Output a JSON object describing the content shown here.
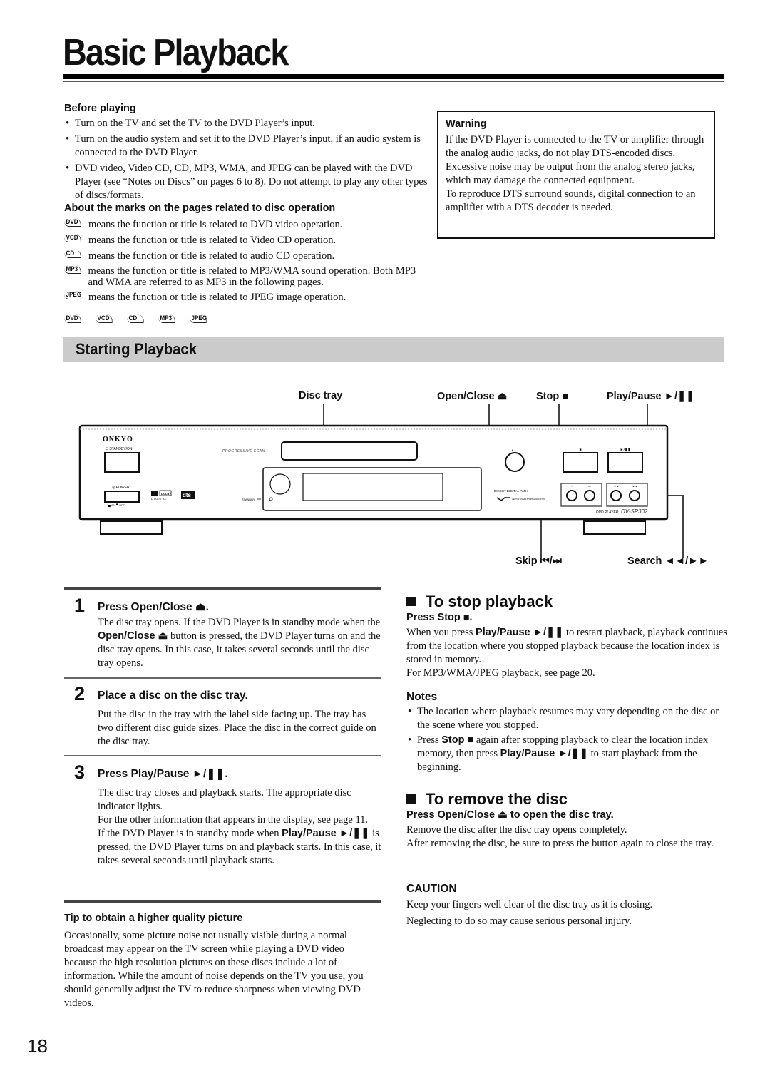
{
  "page": {
    "title": "Basic Playback",
    "page_number": "18"
  },
  "before_playing": {
    "heading": "Before playing",
    "bullets": [
      "Turn on the TV and set the TV to the DVD Player’s input.",
      "Turn on the audio system and set it to the DVD Player’s input, if an audio system is connected to the DVD Player.",
      "DVD video, Video CD, CD, MP3, WMA, and JPEG can be played with the DVD Player (see “Notes on Discs” on pages 6 to 8). Do not attempt to play any other types of discs/formats."
    ]
  },
  "marks": {
    "heading": "About the marks on the pages related to disc operation",
    "items": [
      {
        "icon": "DVD",
        "text": "means the function or title is related to DVD video operation."
      },
      {
        "icon": "VCD",
        "text": "means the function or title is related to Video CD operation."
      },
      {
        "icon": "CD",
        "text": "means the function or title is related to audio CD operation."
      },
      {
        "icon": "MP3",
        "text": "means the function or title is related to MP3/WMA sound operation. Both MP3 and WMA are referred to as MP3 in the following pages."
      },
      {
        "icon": "JPEG",
        "text": "means the function or title is related to JPEG image operation."
      }
    ],
    "applicable": [
      "DVD",
      "VCD",
      "CD",
      "MP3",
      "JPEG"
    ]
  },
  "warning": {
    "heading": "Warning",
    "para1": "If the DVD Player is connected to the TV or amplifier through the analog audio jacks, do not play DTS-encoded discs. Excessive noise may be output from the analog stereo jacks, which may damage the connected equipment.",
    "para2": "To reproduce DTS surround sounds, digital connection to an amplifier with a DTS decoder is needed."
  },
  "starting": {
    "heading": "Starting Playback",
    "callouts": {
      "disc_tray": "Disc tray",
      "open_close": "Open/Close ⏏",
      "stop": "Stop ■",
      "play_pause": "Play/Pause ►/❚❚",
      "skip": "Skip ⏮/⏭",
      "search": "Search ◄◄/►►"
    },
    "device": {
      "brand": "ONKYO",
      "standby_on": "⏻ STANDBY/ON",
      "power": "◎ POWER",
      "on_off": "▄ ON  ▀ OFF",
      "progressive": "PROGRESSIVE SCAN",
      "standby": "STANDBY",
      "dolby": "DOLBY",
      "digital": "D I G I T A L",
      "dts": "dts",
      "direct_digital": "DIRECT DIGITAL PATH",
      "vl": "VECTOR LINEAR SHAPING CIRCUITRY",
      "model_label": "DVD PLAYER",
      "model": "DV-SP302",
      "eject_glyph": "▲",
      "stop_glyph": "■",
      "play_glyph": "►/❚❚",
      "prev_glyph": "⏮",
      "next_glyph": "⏭",
      "rew_glyph": "◄◄",
      "ff_glyph": "►►"
    }
  },
  "steps": [
    {
      "num": "1",
      "title": "Press Open/Close ⏏.",
      "body_a": "The disc tray opens. If the DVD Player is in standby mode when the ",
      "body_b": "Open/Close ⏏",
      "body_c": " button is pressed, the DVD Player turns on and the disc tray opens. In this case, it takes several seconds until the disc tray opens."
    },
    {
      "num": "2",
      "title": "Place a disc on the disc tray.",
      "body_a": "Put the disc in the tray with the label side facing up. The tray has two different disc guide sizes. Place the disc in the correct guide on the disc tray."
    },
    {
      "num": "3",
      "title": "Press Play/Pause ►/❚❚.",
      "body_a": "The disc tray closes and playback starts. The appropriate disc indicator lights.",
      "body_b": "For the other information that appears in the display, see page 11.",
      "body_c": "If the DVD Player is in standby mode when ",
      "body_d": "Play/Pause ►/❚❚",
      "body_e": " is pressed, the DVD Player turns on and playback starts. In this case, it takes several seconds until playback starts."
    }
  ],
  "tip": {
    "heading": "Tip to obtain a higher quality picture",
    "body": "Occasionally, some picture noise not usually visible during a normal broadcast may appear on the TV screen while playing a DVD video because the high resolution pictures on these discs include a lot of information. While the amount of noise depends on the TV you use, you should generally adjust the TV to reduce sharpness when viewing DVD videos."
  },
  "stop": {
    "heading": "To stop playback",
    "subheading": "Press Stop ■.",
    "body_a": "When you press ",
    "body_b": "Play/Pause ►/❚❚",
    "body_c": " to restart playback, playback continues from the location where you stopped playback because the location index is stored in memory.",
    "body_d": "For MP3/WMA/JPEG playback, see page 20."
  },
  "notes": {
    "heading": "Notes",
    "note1": "The location where playback resumes may vary depending on the disc or the scene where you stopped.",
    "note2_a": "Press ",
    "note2_b": "Stop ■",
    "note2_c": " again after stopping playback to clear the location index memory, then press ",
    "note2_d": "Play/Pause ►/❚❚",
    "note2_e": " to start playback from the beginning."
  },
  "remove": {
    "heading": "To remove the disc",
    "subheading": "Press Open/Close ⏏ to open the disc tray.",
    "body1": "Remove the disc after the disc tray opens completely.",
    "body2": "After removing the disc, be sure to press the button again to close the tray."
  },
  "caution": {
    "heading": "CAUTION",
    "line1": "Keep your fingers well clear of the disc tray as it is closing.",
    "line2": "Neglecting to do so may cause serious personal injury."
  }
}
